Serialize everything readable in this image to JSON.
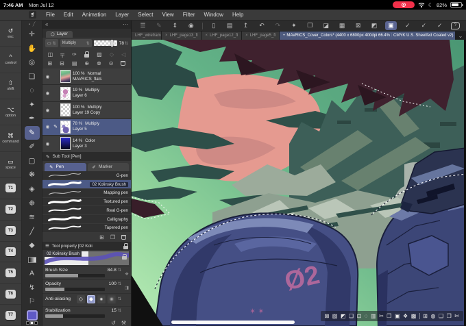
{
  "colors": {
    "accent_selection": "#5b6592",
    "tab_active_blue": "#4d5a7e",
    "record_red": "#f2304a",
    "primary_swatch": "#5f59c6",
    "canvas_sky_green": "#63b287",
    "armor_blue": "#454f85",
    "hair_maroon": "#3f212e",
    "pink_cloud": "#e59a90"
  },
  "status": {
    "time": "7:46 AM",
    "date": "Mon Jul 12",
    "battery": "82%"
  },
  "menubar": {
    "logo_glyph": "❡",
    "items": [
      "File",
      "Edit",
      "Animation",
      "Layer",
      "Select",
      "View",
      "Filter",
      "Window",
      "Help"
    ]
  },
  "dock_toolbar": {
    "icons": [
      {
        "name": "workspace-menu",
        "glyph": "☰"
      },
      {
        "name": "brush-settings",
        "glyph": "✎"
      },
      {
        "name": "collapse-palettes",
        "glyph": "⇕"
      },
      {
        "name": "timelapse",
        "glyph": "◉"
      },
      {
        "name": "connect-device",
        "glyph": "▯"
      },
      {
        "name": "open-file",
        "glyph": "▤"
      },
      {
        "name": "publish",
        "glyph": "↥"
      },
      {
        "name": "undo",
        "glyph": "↶"
      },
      {
        "name": "redo",
        "glyph": "↷"
      },
      {
        "name": "special-select",
        "glyph": "✦"
      },
      {
        "name": "duplicate",
        "glyph": "❐"
      },
      {
        "name": "eraser",
        "glyph": "◪"
      },
      {
        "name": "crop",
        "glyph": "▦"
      },
      {
        "name": "deselect",
        "glyph": "⊠"
      },
      {
        "name": "invert-selection",
        "glyph": "◩"
      },
      {
        "name": "selection-border",
        "glyph": "▣"
      },
      {
        "name": "snap-to-ruler",
        "glyph": "✓"
      },
      {
        "name": "snap-to-special-ruler",
        "glyph": "✓"
      },
      {
        "name": "snap-to-grid",
        "glyph": "✓"
      },
      {
        "name": "help",
        "glyph": "?"
      }
    ]
  },
  "tabs": {
    "items": [
      {
        "label": "LHF_wireframe"
      },
      {
        "label": "LHF_page13_fl"
      },
      {
        "label": "LHF_page12_fl"
      },
      {
        "label": "LHF_page5_fl"
      }
    ],
    "close_glyph": "×",
    "overflow_glyph": "⌄",
    "active": {
      "bullet": "•",
      "label": "MAVRICS_Cover_Colors* (4400 x 6800px 400dpi 66.4% : CMYK:U.S. Sheetfed Coated v2)"
    }
  },
  "edge_keyboard": {
    "keys": [
      {
        "icon": "↺",
        "label": "esc"
      },
      {
        "icon": "^",
        "label": "control"
      },
      {
        "icon": "⇧",
        "label": "shift"
      },
      {
        "icon": "⌥",
        "label": "option"
      },
      {
        "icon": "⌘",
        "label": "command"
      },
      {
        "icon": "▭",
        "label": "space"
      },
      {
        "label": "T1"
      },
      {
        "label": "T2"
      },
      {
        "label": "T3"
      },
      {
        "label": "T4"
      },
      {
        "label": "T5"
      },
      {
        "label": "T6"
      },
      {
        "label": "T7"
      }
    ]
  },
  "tool_palette": {
    "tools": [
      {
        "name": "move",
        "glyph": "✛"
      },
      {
        "name": "hand",
        "glyph": "✋"
      },
      {
        "name": "zoom",
        "glyph": "◎"
      },
      {
        "name": "operation",
        "glyph": "❏"
      },
      {
        "name": "lasso",
        "glyph": "◌"
      },
      {
        "name": "auto-select",
        "glyph": "✦"
      },
      {
        "name": "eyedropper",
        "glyph": "✒"
      },
      {
        "name": "pen",
        "glyph": "✎"
      },
      {
        "name": "brush",
        "glyph": "✐"
      },
      {
        "name": "marquee",
        "glyph": "▢"
      },
      {
        "name": "airbrush",
        "glyph": "❋"
      },
      {
        "name": "eraser",
        "glyph": "◈"
      },
      {
        "name": "blend",
        "glyph": "❉"
      },
      {
        "name": "blur",
        "glyph": "≋"
      },
      {
        "name": "line",
        "glyph": "╱"
      },
      {
        "name": "fill",
        "glyph": "◆"
      },
      {
        "name": "gradient",
        "glyph": ""
      },
      {
        "name": "text",
        "glyph": "A"
      },
      {
        "name": "correct-line",
        "glyph": "↯"
      },
      {
        "name": "figure",
        "glyph": "⚐"
      }
    ]
  },
  "layer_panel": {
    "collapse_glyph": "«",
    "more_glyph": "⋯",
    "tab_label": "Layer",
    "tab_icon": "⬡",
    "blend_mode": "Multiply",
    "stepper_glyph": "⇅",
    "opacity_value": "78",
    "eye_glyph": "◉",
    "edit_glyph": "✎",
    "commands_row1": [
      {
        "name": "change-panel-color",
        "glyph": "◫"
      },
      {
        "name": "clip-to-layer-below",
        "glyph": "╤"
      },
      {
        "name": "set-as-draft",
        "glyph": "✑"
      },
      {
        "name": "lock-layer",
        "glyph": ""
      },
      {
        "name": "lock-transparent-pixels",
        "glyph": "▨"
      },
      {
        "name": "enable-mask",
        "glyph": "◇"
      },
      {
        "name": "set-as-ruler",
        "glyph": "◁"
      }
    ],
    "commands_row2": [
      {
        "name": "new-raster-layer",
        "glyph": "⊞"
      },
      {
        "name": "new-vector-layer",
        "glyph": "⊟"
      },
      {
        "name": "new-folder",
        "glyph": "▤"
      },
      {
        "name": "merge-down",
        "glyph": "⊕"
      },
      {
        "name": "combine-layers",
        "glyph": "⊗"
      },
      {
        "name": "layer-mask",
        "glyph": "⊙"
      },
      {
        "name": "delete-layer",
        "glyph": ""
      }
    ],
    "layers": [
      {
        "opacity": "100 %",
        "mode": "Normal",
        "name": "MAVRICS_flats"
      },
      {
        "opacity": "19 %",
        "mode": "Multiply",
        "name": "Layer 6"
      },
      {
        "opacity": "100 %",
        "mode": "Multiply",
        "name": "Layer 19 Copy"
      },
      {
        "opacity": "78 %",
        "mode": "Multiply",
        "name": "Layer 5"
      },
      {
        "opacity": "14 %",
        "mode": "Color",
        "name": "Layer 3"
      }
    ]
  },
  "subtool": {
    "title": "Sub Tool [Pen]",
    "title_icon": "✎",
    "tabs": [
      {
        "icon": "✎",
        "label": "Pen"
      },
      {
        "icon": "✐",
        "label": "Marker"
      }
    ],
    "brushes": [
      {
        "name": "G-pen"
      },
      {
        "name": "02 Kolinsky Brush"
      },
      {
        "name": "Mapping pen"
      },
      {
        "name": "Textured pen"
      },
      {
        "name": "Real G-pen"
      },
      {
        "name": "Calligraphy"
      },
      {
        "name": "Tapered pen"
      }
    ],
    "footer": {
      "add_glyph": "⊞",
      "duplicate_glyph": "❐"
    }
  },
  "tool_property": {
    "menu_glyph": "☰",
    "title": "Tool property [02 Koli",
    "brush_name": "02 Kolinsky Brush",
    "brush_size": {
      "label": "Brush Size",
      "value": "84.8"
    },
    "opacity": {
      "label": "Opacity",
      "value": "100"
    },
    "anti_aliasing": {
      "label": "Anti-aliasing"
    },
    "stabilization": {
      "label": "Stabilization",
      "value": "15"
    },
    "stepper_glyph": "⇅",
    "aa_sharp": "◇",
    "aa_mid": "◆",
    "aa_soft": "●",
    "aa_softer": "●",
    "footer": {
      "reset_glyph": "↺",
      "wrench_glyph": "⚒"
    }
  },
  "command_bar": {
    "icons": [
      {
        "name": "deselect",
        "glyph": "⊠"
      },
      {
        "name": "reselect",
        "glyph": "▧"
      },
      {
        "name": "invert-selection",
        "glyph": "◩"
      },
      {
        "name": "scale-rotate",
        "glyph": "❏"
      },
      {
        "name": "expand-selection",
        "glyph": "⊡"
      },
      {
        "name": "lasso",
        "glyph": "◌"
      },
      {
        "name": "copy-merged",
        "glyph": "▥"
      },
      {
        "name": "cut",
        "glyph": "✂"
      },
      {
        "name": "copy",
        "glyph": "❐"
      },
      {
        "name": "paste",
        "glyph": "▣"
      },
      {
        "name": "fill",
        "glyph": "❖"
      },
      {
        "name": "tone",
        "glyph": "▩"
      },
      {
        "name": "new-layer",
        "glyph": "⊞"
      },
      {
        "name": "select-launcher",
        "glyph": "◍"
      },
      {
        "name": "duplicate-layer",
        "glyph": "❑"
      },
      {
        "name": "paste-clipboard",
        "glyph": "❒"
      },
      {
        "name": "scissors",
        "glyph": "✄"
      }
    ]
  },
  "canvas": {
    "armor_number": "Ø2",
    "star_marks": "✶ ✶"
  }
}
